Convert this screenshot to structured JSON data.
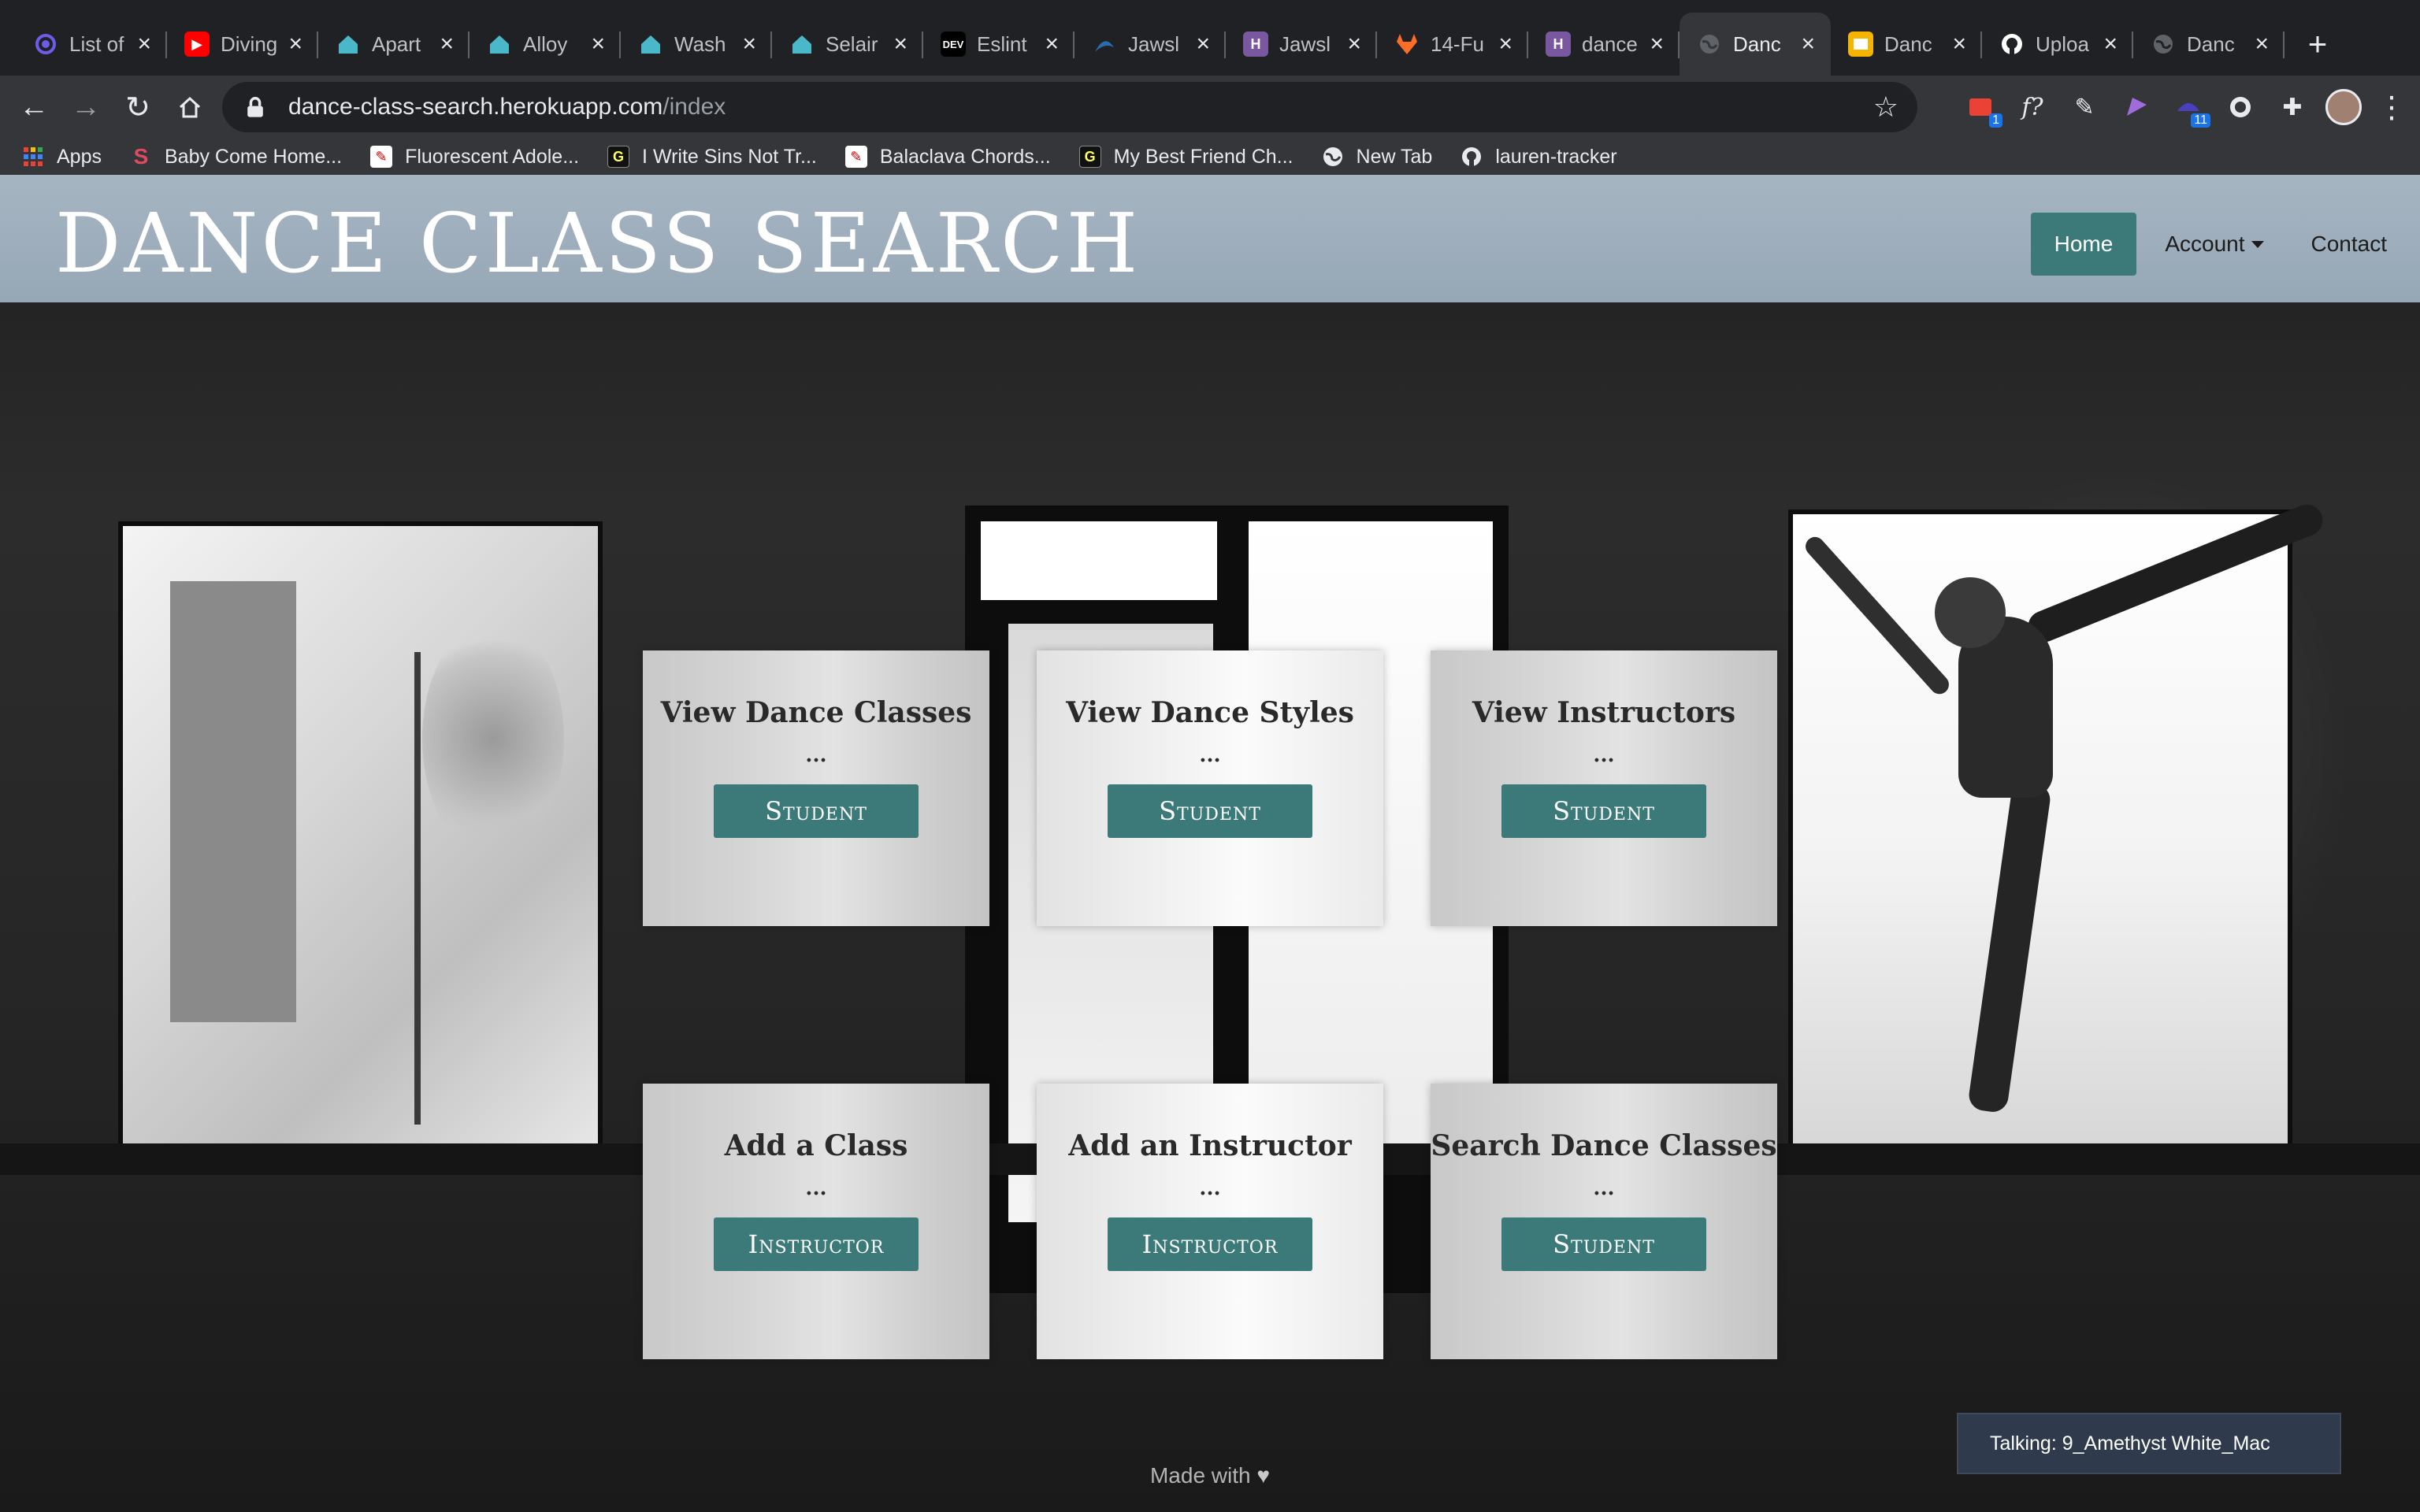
{
  "browser": {
    "tabs": [
      {
        "title": "List of",
        "icon": "circle-icon",
        "color": "#6c5ce7"
      },
      {
        "title": "Diving",
        "icon": "youtube-icon",
        "color": "#ff0000"
      },
      {
        "title": "Apart",
        "icon": "home-icon",
        "color": "#4bb8c9"
      },
      {
        "title": "Alloy",
        "icon": "home-icon",
        "color": "#4bb8c9"
      },
      {
        "title": "Wash",
        "icon": "home-icon",
        "color": "#4bb8c9"
      },
      {
        "title": "Selair",
        "icon": "home-icon",
        "color": "#4bb8c9"
      },
      {
        "title": "Eslint",
        "icon": "dev-icon",
        "color": "#000000"
      },
      {
        "title": "Jawsl",
        "icon": "jaws-icon",
        "color": "#2c6ab0"
      },
      {
        "title": "Jawsl",
        "icon": "heroku-icon",
        "color": "#79589f"
      },
      {
        "title": "14-Fu",
        "icon": "gitlab-icon",
        "color": "#fc6d26"
      },
      {
        "title": "dance",
        "icon": "heroku-icon",
        "color": "#79589f"
      },
      {
        "title": "Danc",
        "icon": "globe-icon",
        "color": "#5f6368",
        "active": true
      },
      {
        "title": "Danc",
        "icon": "slides-icon",
        "color": "#f4b400"
      },
      {
        "title": "Uploa",
        "icon": "github-icon",
        "color": "#ffffff"
      },
      {
        "title": "Danc",
        "icon": "globe-icon",
        "color": "#5f6368"
      }
    ],
    "address": {
      "host": "dance-class-search.herokuapp.com",
      "path": "/index"
    },
    "bookmarks": [
      {
        "label": "Apps",
        "icon": "apps-grid-icon"
      },
      {
        "label": "Baby Come Home...",
        "icon": "s-logo-icon"
      },
      {
        "label": "Fluorescent Adole...",
        "icon": "guitar-icon"
      },
      {
        "label": "I Write Sins Not Tr...",
        "icon": "genius-icon"
      },
      {
        "label": "Balaclava Chords...",
        "icon": "guitar-icon"
      },
      {
        "label": "My Best Friend Ch...",
        "icon": "genius-icon"
      },
      {
        "label": "New Tab",
        "icon": "globe-icon"
      },
      {
        "label": "lauren-tracker",
        "icon": "github-icon"
      }
    ],
    "extension_badges": {
      "first": "1",
      "second": "11"
    }
  },
  "site": {
    "title": "DANCE CLASS SEARCH",
    "nav": {
      "home": "Home",
      "account": "Account",
      "contact": "Contact"
    },
    "cards": [
      {
        "title": "View Dance Classes",
        "dots": "...",
        "button": "Student"
      },
      {
        "title": "View Dance Styles",
        "dots": "...",
        "button": "Student"
      },
      {
        "title": "View Instructors",
        "dots": "...",
        "button": "Student"
      },
      {
        "title": "Add a Class",
        "dots": "...",
        "button": "Instructor"
      },
      {
        "title": "Add an Instructor",
        "dots": "...",
        "button": "Instructor"
      },
      {
        "title": "Search Dance Classes",
        "dots": "...",
        "button": "Student"
      }
    ],
    "footer": "Made with",
    "talking": "Talking: 9_Amethyst White_Mac"
  },
  "colors": {
    "accent": "#3c7a7a",
    "header_bg": "#9fb0bf",
    "talking_bg": "#2f3b4c"
  }
}
